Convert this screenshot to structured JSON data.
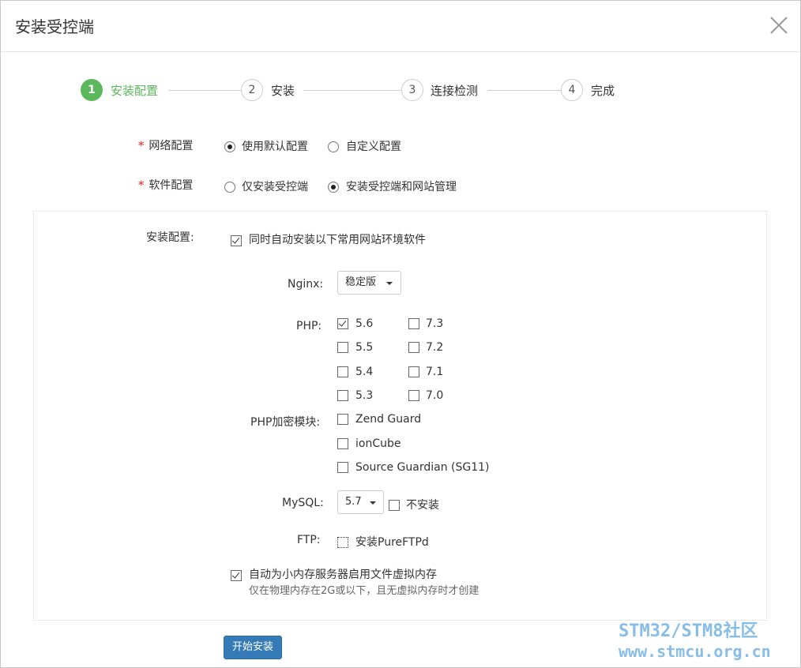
{
  "dialog": {
    "title": "安装受控端"
  },
  "steps": [
    {
      "num": "1",
      "label": "安装配置"
    },
    {
      "num": "2",
      "label": "安装"
    },
    {
      "num": "3",
      "label": "连接检测"
    },
    {
      "num": "4",
      "label": "完成"
    }
  ],
  "form": {
    "required_mark": "*",
    "network": {
      "label": "网络配置",
      "options": [
        "使用默认配置",
        "自定义配置"
      ],
      "selected": "使用默认配置"
    },
    "software": {
      "label": "软件配置",
      "options": [
        "仅安装受控端",
        "安装受控端和网站管理"
      ],
      "selected": "安装受控端和网站管理"
    }
  },
  "install_config": {
    "label": "安装配置:",
    "auto_install": {
      "text": "同时自动安装以下常用网站环境软件",
      "checked": true
    },
    "nginx": {
      "label": "Nginx:",
      "value": "稳定版"
    },
    "php": {
      "label": "PHP:",
      "versions": [
        {
          "v": "5.6",
          "checked": true
        },
        {
          "v": "7.3",
          "checked": false
        },
        {
          "v": "5.5",
          "checked": false
        },
        {
          "v": "7.2",
          "checked": false
        },
        {
          "v": "5.4",
          "checked": false
        },
        {
          "v": "7.1",
          "checked": false
        },
        {
          "v": "5.3",
          "checked": false
        },
        {
          "v": "7.0",
          "checked": false
        }
      ]
    },
    "php_encrypt": {
      "label": "PHP加密模块:",
      "modules": [
        "Zend Guard",
        "ionCube",
        "Source Guardian (SG11)"
      ]
    },
    "mysql": {
      "label": "MySQL:",
      "value": "5.7",
      "no_install": "不安装"
    },
    "ftp": {
      "label": "FTP:",
      "option": "安装PureFTPd"
    },
    "swap": {
      "text": "自动为小内存服务器启用文件虚拟内存",
      "hint": "仅在物理内存在2G或以下，且无虚拟内存时才创建",
      "checked": true
    }
  },
  "actions": {
    "start": "开始安装"
  },
  "watermark": {
    "line1": "STM32/STM8社区",
    "line2": "www.stmcu.org.cn"
  },
  "colors": {
    "accent": "#5cb85c",
    "primary": "#337ab7",
    "required": "#d9534f",
    "watermark": "#87bde6"
  }
}
